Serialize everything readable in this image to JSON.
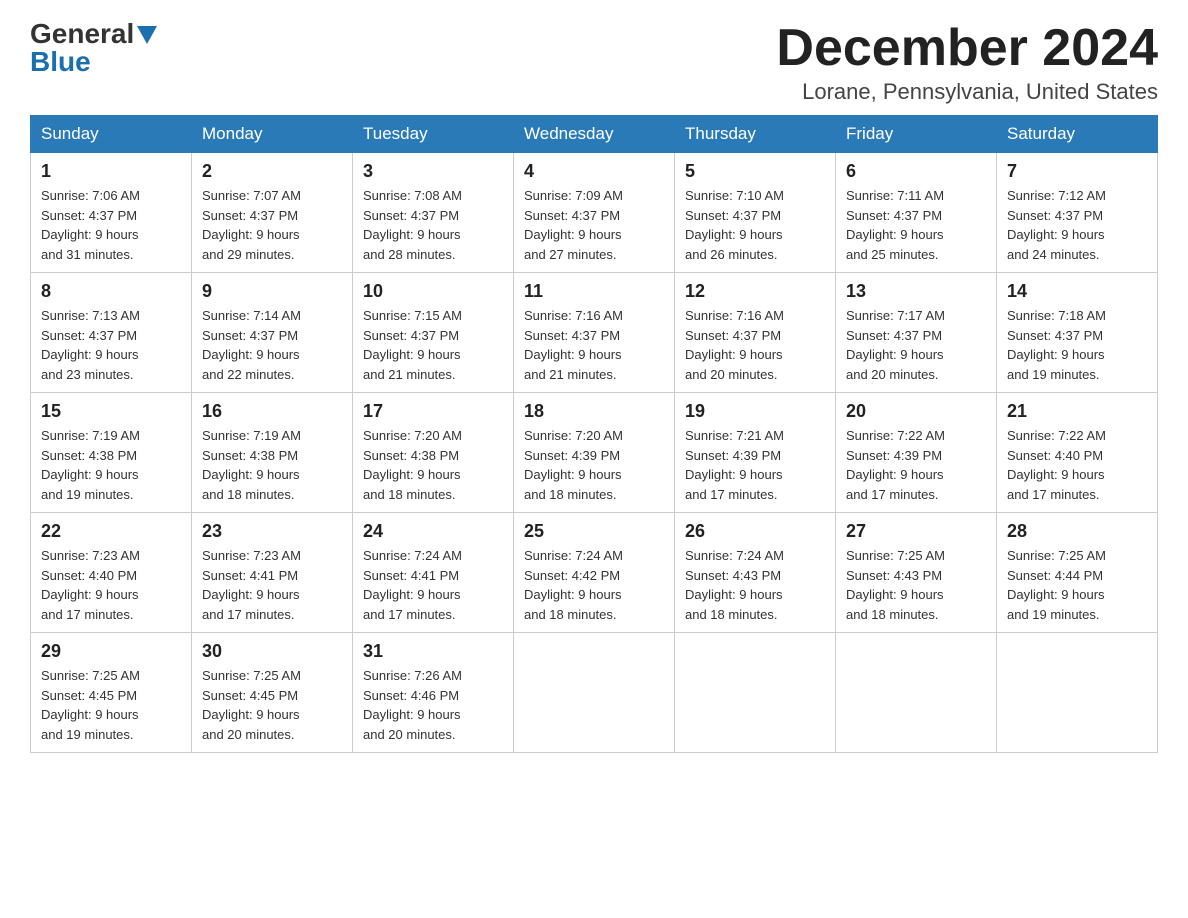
{
  "logo": {
    "general": "General",
    "blue": "Blue"
  },
  "title": {
    "month": "December 2024",
    "location": "Lorane, Pennsylvania, United States"
  },
  "headers": [
    "Sunday",
    "Monday",
    "Tuesday",
    "Wednesday",
    "Thursday",
    "Friday",
    "Saturday"
  ],
  "weeks": [
    [
      {
        "day": "1",
        "sunrise": "7:06 AM",
        "sunset": "4:37 PM",
        "daylight": "9 hours and 31 minutes."
      },
      {
        "day": "2",
        "sunrise": "7:07 AM",
        "sunset": "4:37 PM",
        "daylight": "9 hours and 29 minutes."
      },
      {
        "day": "3",
        "sunrise": "7:08 AM",
        "sunset": "4:37 PM",
        "daylight": "9 hours and 28 minutes."
      },
      {
        "day": "4",
        "sunrise": "7:09 AM",
        "sunset": "4:37 PM",
        "daylight": "9 hours and 27 minutes."
      },
      {
        "day": "5",
        "sunrise": "7:10 AM",
        "sunset": "4:37 PM",
        "daylight": "9 hours and 26 minutes."
      },
      {
        "day": "6",
        "sunrise": "7:11 AM",
        "sunset": "4:37 PM",
        "daylight": "9 hours and 25 minutes."
      },
      {
        "day": "7",
        "sunrise": "7:12 AM",
        "sunset": "4:37 PM",
        "daylight": "9 hours and 24 minutes."
      }
    ],
    [
      {
        "day": "8",
        "sunrise": "7:13 AM",
        "sunset": "4:37 PM",
        "daylight": "9 hours and 23 minutes."
      },
      {
        "day": "9",
        "sunrise": "7:14 AM",
        "sunset": "4:37 PM",
        "daylight": "9 hours and 22 minutes."
      },
      {
        "day": "10",
        "sunrise": "7:15 AM",
        "sunset": "4:37 PM",
        "daylight": "9 hours and 21 minutes."
      },
      {
        "day": "11",
        "sunrise": "7:16 AM",
        "sunset": "4:37 PM",
        "daylight": "9 hours and 21 minutes."
      },
      {
        "day": "12",
        "sunrise": "7:16 AM",
        "sunset": "4:37 PM",
        "daylight": "9 hours and 20 minutes."
      },
      {
        "day": "13",
        "sunrise": "7:17 AM",
        "sunset": "4:37 PM",
        "daylight": "9 hours and 20 minutes."
      },
      {
        "day": "14",
        "sunrise": "7:18 AM",
        "sunset": "4:37 PM",
        "daylight": "9 hours and 19 minutes."
      }
    ],
    [
      {
        "day": "15",
        "sunrise": "7:19 AM",
        "sunset": "4:38 PM",
        "daylight": "9 hours and 19 minutes."
      },
      {
        "day": "16",
        "sunrise": "7:19 AM",
        "sunset": "4:38 PM",
        "daylight": "9 hours and 18 minutes."
      },
      {
        "day": "17",
        "sunrise": "7:20 AM",
        "sunset": "4:38 PM",
        "daylight": "9 hours and 18 minutes."
      },
      {
        "day": "18",
        "sunrise": "7:20 AM",
        "sunset": "4:39 PM",
        "daylight": "9 hours and 18 minutes."
      },
      {
        "day": "19",
        "sunrise": "7:21 AM",
        "sunset": "4:39 PM",
        "daylight": "9 hours and 17 minutes."
      },
      {
        "day": "20",
        "sunrise": "7:22 AM",
        "sunset": "4:39 PM",
        "daylight": "9 hours and 17 minutes."
      },
      {
        "day": "21",
        "sunrise": "7:22 AM",
        "sunset": "4:40 PM",
        "daylight": "9 hours and 17 minutes."
      }
    ],
    [
      {
        "day": "22",
        "sunrise": "7:23 AM",
        "sunset": "4:40 PM",
        "daylight": "9 hours and 17 minutes."
      },
      {
        "day": "23",
        "sunrise": "7:23 AM",
        "sunset": "4:41 PM",
        "daylight": "9 hours and 17 minutes."
      },
      {
        "day": "24",
        "sunrise": "7:24 AM",
        "sunset": "4:41 PM",
        "daylight": "9 hours and 17 minutes."
      },
      {
        "day": "25",
        "sunrise": "7:24 AM",
        "sunset": "4:42 PM",
        "daylight": "9 hours and 18 minutes."
      },
      {
        "day": "26",
        "sunrise": "7:24 AM",
        "sunset": "4:43 PM",
        "daylight": "9 hours and 18 minutes."
      },
      {
        "day": "27",
        "sunrise": "7:25 AM",
        "sunset": "4:43 PM",
        "daylight": "9 hours and 18 minutes."
      },
      {
        "day": "28",
        "sunrise": "7:25 AM",
        "sunset": "4:44 PM",
        "daylight": "9 hours and 19 minutes."
      }
    ],
    [
      {
        "day": "29",
        "sunrise": "7:25 AM",
        "sunset": "4:45 PM",
        "daylight": "9 hours and 19 minutes."
      },
      {
        "day": "30",
        "sunrise": "7:25 AM",
        "sunset": "4:45 PM",
        "daylight": "9 hours and 20 minutes."
      },
      {
        "day": "31",
        "sunrise": "7:26 AM",
        "sunset": "4:46 PM",
        "daylight": "9 hours and 20 minutes."
      },
      null,
      null,
      null,
      null
    ]
  ],
  "labels": {
    "sunrise": "Sunrise:",
    "sunset": "Sunset:",
    "daylight": "Daylight:"
  }
}
